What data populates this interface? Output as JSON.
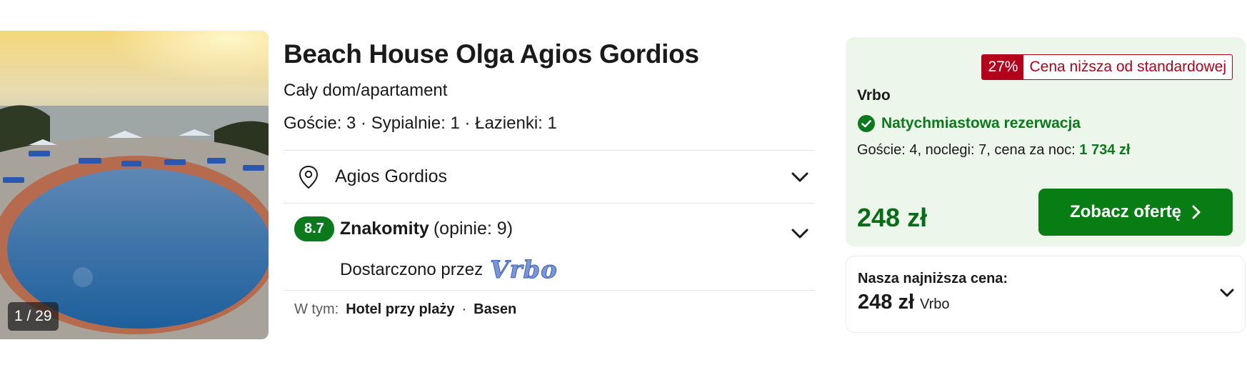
{
  "photo": {
    "counter": "1 / 29"
  },
  "hotel": {
    "name": "Beach House Olga Agios Gordios",
    "property_type": "Cały dom/apartament",
    "amenities_line": "Goście: 3 · Sypialnie: 1 · Łazienki: 1",
    "location": "Agios Gordios",
    "rating": {
      "score": "8.7",
      "word": "Znakomity",
      "count": "(opinie: 9)"
    },
    "provided_by_label": "Dostarczono przez",
    "provided_by_logo": "Vrbo",
    "includes": {
      "label": "W tym:",
      "items": [
        "Hotel przy plaży",
        "Basen"
      ]
    }
  },
  "offer": {
    "deal_percent": "27%",
    "deal_text": "Cena niższa od standardowej",
    "provider": "Vrbo",
    "instant_booking": "Natychmiastowa rezerwacja",
    "meta_text": "Goście: 4, noclegi: 7, cena za noc: ",
    "meta_price": "1 734 zł",
    "total_price": "248 zł",
    "cta_label": "Zobacz ofertę"
  },
  "lowest": {
    "label": "Nasza najniższa cena:",
    "price": "248 zł",
    "provider": "Vrbo"
  },
  "colors": {
    "brand_green": "#0a7a1c",
    "deal_red": "#b3001b",
    "offer_bg": "#ecf6ea"
  },
  "icons": [
    "map-pin-icon",
    "chevron-down-icon",
    "check-circle-icon",
    "chevron-right-icon"
  ]
}
